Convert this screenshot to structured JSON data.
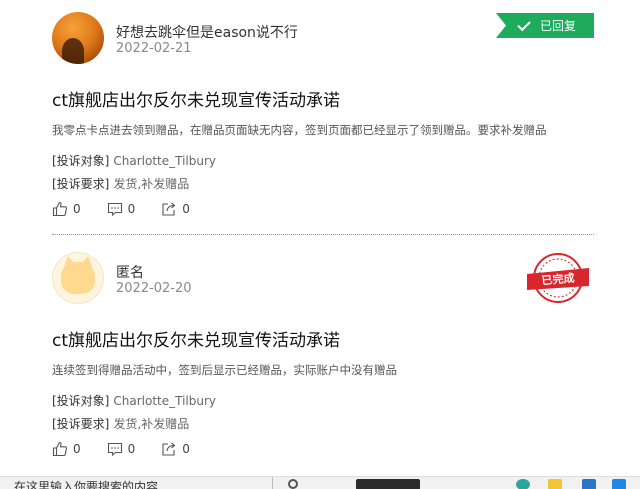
{
  "posts": [
    {
      "username": "好想去跳伞但是eason说不行",
      "date": "2022-02-21",
      "status": "已回复",
      "title": "ct旗舰店出尔反尔未兑现宣传活动承诺",
      "description": "我零点卡点进去领到赠品，在赠品页面缺无内容，签到页面都已经显示了领到赠品。要求补发赠品",
      "target_label": "[投诉对象]",
      "target_value": "Charlotte_Tilbury",
      "request_label": "[投诉要求]",
      "request_value": "发货,补发赠品",
      "likes": "0",
      "comments": "0",
      "shares": "0"
    },
    {
      "username": "匿名",
      "date": "2022-02-20",
      "status": "已完成",
      "title": "ct旗舰店出尔反尔未兑现宣传活动承诺",
      "description": "连续签到得赠品活动中，签到后显示已经赠品，实际账户中没有赠品",
      "target_label": "[投诉对象]",
      "target_value": "Charlotte_Tilbury",
      "request_label": "[投诉要求]",
      "request_value": "发货,补发赠品",
      "likes": "0",
      "comments": "0",
      "shares": "0"
    }
  ],
  "taskbar": {
    "search_placeholder": "在这里输入你要搜索的内容"
  },
  "colors": {
    "replied_green": "#1eab5b",
    "completed_red": "#d9262c"
  }
}
